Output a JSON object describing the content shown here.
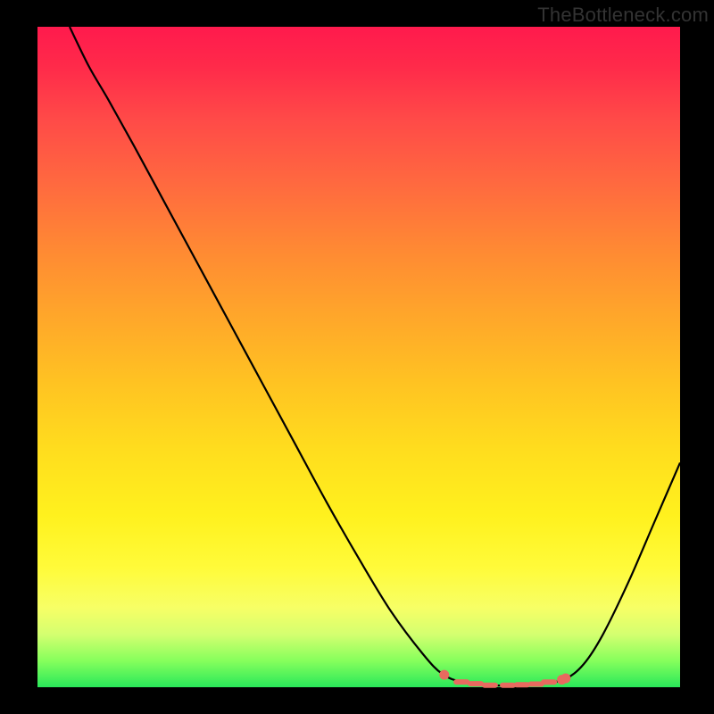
{
  "watermark": "TheBottleneck.com",
  "chart_data": {
    "type": "line",
    "title": "",
    "xlabel": "",
    "ylabel": "",
    "xlim": [
      0,
      100
    ],
    "ylim": [
      0,
      100
    ],
    "series": [
      {
        "name": "curve",
        "points": [
          {
            "x": 5.0,
            "y": 100.0
          },
          {
            "x": 8.0,
            "y": 94.0
          },
          {
            "x": 11.0,
            "y": 89.0
          },
          {
            "x": 15.0,
            "y": 82.0
          },
          {
            "x": 20.0,
            "y": 73.0
          },
          {
            "x": 25.0,
            "y": 64.0
          },
          {
            "x": 30.0,
            "y": 55.0
          },
          {
            "x": 35.0,
            "y": 46.0
          },
          {
            "x": 40.0,
            "y": 37.0
          },
          {
            "x": 45.0,
            "y": 28.0
          },
          {
            "x": 50.0,
            "y": 19.5
          },
          {
            "x": 55.0,
            "y": 11.5
          },
          {
            "x": 60.0,
            "y": 5.0
          },
          {
            "x": 63.0,
            "y": 2.0
          },
          {
            "x": 66.0,
            "y": 0.8
          },
          {
            "x": 70.0,
            "y": 0.3
          },
          {
            "x": 74.0,
            "y": 0.3
          },
          {
            "x": 78.0,
            "y": 0.5
          },
          {
            "x": 82.0,
            "y": 1.2
          },
          {
            "x": 85.0,
            "y": 3.5
          },
          {
            "x": 88.0,
            "y": 8.0
          },
          {
            "x": 92.0,
            "y": 16.0
          },
          {
            "x": 96.0,
            "y": 25.0
          },
          {
            "x": 100.0,
            "y": 34.0
          }
        ]
      }
    ],
    "highlight": {
      "dots_x": [
        63.3,
        81.6,
        82.2
      ],
      "dashes_x": [
        66.0,
        68.2,
        70.4,
        73.2,
        75.4,
        77.6,
        79.6
      ]
    },
    "gradient_stops": [
      {
        "pos": 0.0,
        "color": "#ff1a4d"
      },
      {
        "pos": 0.5,
        "color": "#ffc322"
      },
      {
        "pos": 0.82,
        "color": "#fffb3a"
      },
      {
        "pos": 1.0,
        "color": "#29e85a"
      }
    ]
  }
}
